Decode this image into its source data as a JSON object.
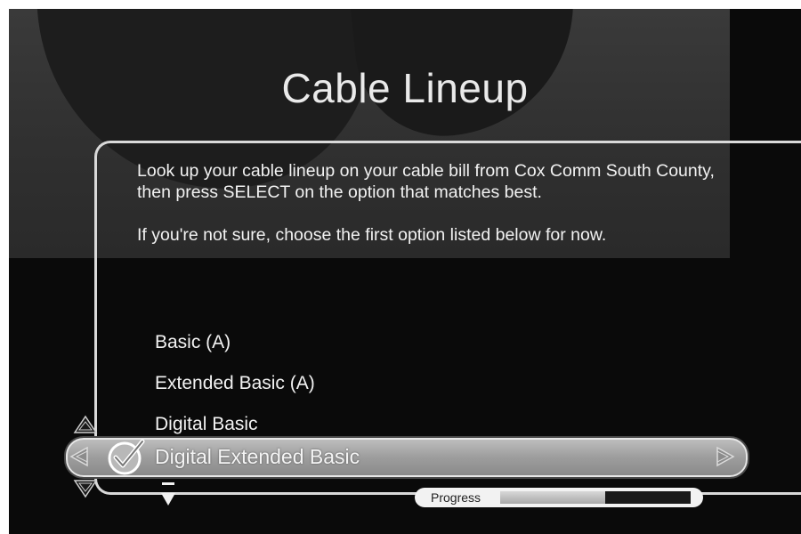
{
  "title": "Cable Lineup",
  "instructions": [
    "Look up your cable lineup on your cable bill from Cox Comm South County, then press SELECT on the option that matches best.",
    "If you're not sure, choose the first option listed below for now."
  ],
  "options": [
    "Basic (A)",
    "Extended Basic (A)",
    "Digital Basic"
  ],
  "selected_option": "Digital Extended Basic",
  "progress": {
    "label": "Progress",
    "value": 0.55
  },
  "icons": {
    "check": "checkmark-icon",
    "left": "left-arrow-icon",
    "right": "right-arrow-icon",
    "up": "up-arrow-icon",
    "down": "down-arrow-icon",
    "more": "more-below-icon"
  }
}
